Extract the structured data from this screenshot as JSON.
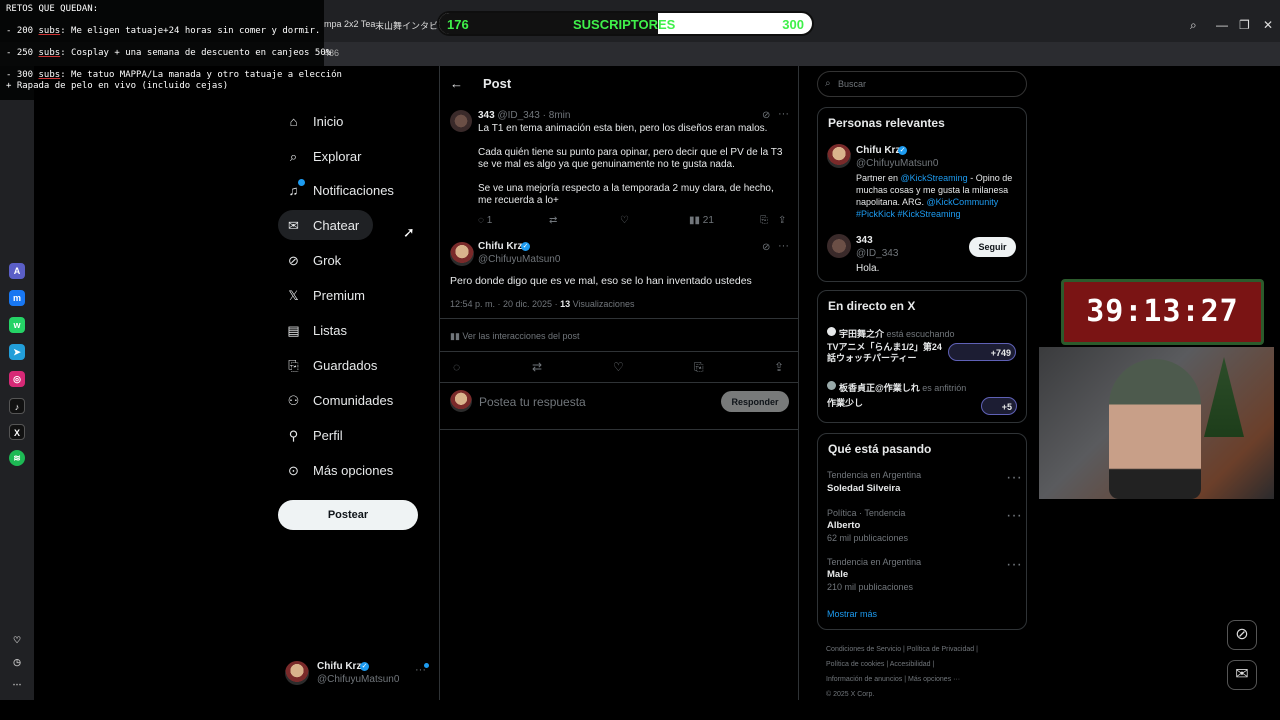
{
  "overlay": {
    "retos_title": "RETOS QUE QUEDAN:",
    "retos": [
      {
        "count": "- 200",
        "subs": "subs",
        "text": ": Me eligen tatuaje+24 horas sin comer y dormir."
      },
      {
        "count": "- 250",
        "subs": "subs",
        "text": ": Cosplay + una semana de descuento en canjeos 50%"
      },
      {
        "count": "- 300",
        "subs": "subs",
        "text": ": Me tatuo MAPPA/La manada y otro tatuaje a elección\n+ Rapada de pelo en vivo (incluido cejas)"
      }
    ],
    "sub_current": "176",
    "sub_label": "SUSCRIPTORES",
    "sub_goal": "300",
    "sub_progress": 0.587,
    "timer": "39:13:27"
  },
  "browser": {
    "tabs": [
      "mpa 2x2 Tea",
      "末山舞インタビ"
    ],
    "address_fragment": "486",
    "window_controls": [
      "search-icon",
      "minimize-icon",
      "restore-icon",
      "close-icon"
    ]
  },
  "nav": {
    "items": [
      {
        "label": "Inicio",
        "icon": "home-icon"
      },
      {
        "label": "Explorar",
        "icon": "search-icon"
      },
      {
        "label": "Notificaciones",
        "icon": "bell-icon"
      },
      {
        "label": "Chatear",
        "icon": "mail-icon"
      },
      {
        "label": "Grok",
        "icon": "grok-icon"
      },
      {
        "label": "Premium",
        "icon": "x-logo-icon"
      },
      {
        "label": "Listas",
        "icon": "list-icon"
      },
      {
        "label": "Guardados",
        "icon": "bookmark-icon"
      },
      {
        "label": "Comunidades",
        "icon": "communities-icon"
      },
      {
        "label": "Perfil",
        "icon": "person-icon"
      },
      {
        "label": "Más opciones",
        "icon": "more-circle-icon"
      }
    ],
    "post_button": "Postear",
    "me": {
      "name": "Chifu Krz",
      "handle": "@ChifuyuMatsun0"
    }
  },
  "center": {
    "header_title": "Post",
    "reply": {
      "author": "343",
      "handle": "@ID_343",
      "time": "· 8min",
      "text1": "La T1 en tema animación esta bien, pero los diseños eran malos.",
      "text2": " Cada quién tiene su punto para opinar, pero decir que el PV de la T3 se ve mal es algo ya que genuinamente no te gusta nada.",
      "text3": " Se ve una mejoría respecto a la temporada 2 muy clara, de hecho, me recuerda a lo+",
      "replies": "1",
      "views": "21"
    },
    "main": {
      "author": "Chifu Krz",
      "handle": "@ChifuyuMatsun0",
      "text": "Pero donde digo que es ve mal, eso se lo han inventado ustedes",
      "date": "12:54 p. m. · 20 dic. 2025 · ",
      "views_count": "13",
      "views_label": " Visualizaciones",
      "interactions": "Ver las interacciones del post"
    },
    "compose_placeholder": "Postea tu respuesta",
    "compose_button": "Responder"
  },
  "right": {
    "search_placeholder": "Buscar",
    "relevant_title": "Personas relevantes",
    "person1": {
      "name": "Chifu Krz",
      "handle": "@ChifuyuMatsun0",
      "bio_a": "Partner en ",
      "bio_link1": "@KickStreaming",
      "bio_b": " - Opino de muchas cosas y me gusta la milanesa napolitana. ARG. ",
      "bio_link2": "@KickCommunity",
      "bio_tags": "#PickKick #KickStreaming"
    },
    "person2": {
      "name": "343",
      "handle": "@ID_343",
      "bio": "Hola.",
      "follow": "Seguir"
    },
    "live_title": "En directo en X",
    "live1": {
      "host": "宇田舞之介",
      "status": " está escuchando",
      "title": "TVアニメ「らんま1/2」第24話ウォッチパーティー",
      "count": "+749"
    },
    "live2": {
      "host": "板香貞正@作業しれ",
      "status": " es anfitrión",
      "title": "作業少し",
      "count": "+5"
    },
    "trends_title": "Qué está pasando",
    "trends": [
      {
        "context": "Tendencia en Argentina",
        "name": "Soledad Silveira",
        "posts": ""
      },
      {
        "context": "Política · Tendencia",
        "name": "Alberto",
        "posts": "62 mil publicaciones"
      },
      {
        "context": "Tendencia en Argentina",
        "name": "Male",
        "posts": "210 mil publicaciones"
      }
    ],
    "show_more": "Mostrar más",
    "footer": [
      "Condiciones de Servicio",
      "Política de Privacidad",
      "Política de cookies",
      "Accesibilidad",
      "Información de anuncios",
      "Más opciones ···",
      "© 2025 X Corp."
    ]
  }
}
